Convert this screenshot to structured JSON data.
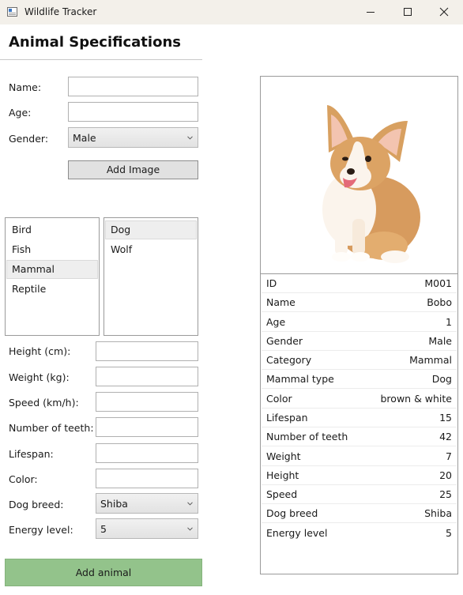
{
  "window": {
    "title": "Wildlife Tracker"
  },
  "form": {
    "heading": "Animal Specifications",
    "name_label": "Name:",
    "name_value": "",
    "age_label": "Age:",
    "age_value": "",
    "gender_label": "Gender:",
    "gender_value": "Male",
    "add_image_label": "Add Image"
  },
  "categories": {
    "items": [
      "Bird",
      "Fish",
      "Mammal",
      "Reptile"
    ],
    "selected": "Mammal"
  },
  "subtypes": {
    "items": [
      "Dog",
      "Wolf"
    ],
    "selected": "Dog"
  },
  "specs": {
    "height_label": "Height (cm):",
    "weight_label": "Weight (kg):",
    "speed_label": "Speed (km/h):",
    "teeth_label": "Number of teeth:",
    "lifespan_label": "Lifespan:",
    "color_label": "Color:",
    "breed_label": "Dog breed:",
    "breed_value": "Shiba",
    "energy_label": "Energy level:",
    "energy_value": "5"
  },
  "add_animal_label": "Add animal",
  "details": [
    {
      "key": "ID",
      "value": "M001"
    },
    {
      "key": "Name",
      "value": "Bobo"
    },
    {
      "key": "Age",
      "value": "1"
    },
    {
      "key": "Gender",
      "value": "Male"
    },
    {
      "key": "Category",
      "value": "Mammal"
    },
    {
      "key": "Mammal type",
      "value": "Dog"
    },
    {
      "key": "Color",
      "value": "brown & white"
    },
    {
      "key": "Lifespan",
      "value": "15"
    },
    {
      "key": "Number of teeth",
      "value": "42"
    },
    {
      "key": "Weight",
      "value": "7"
    },
    {
      "key": "Height",
      "value": "20"
    },
    {
      "key": "Speed",
      "value": "25"
    },
    {
      "key": "Dog breed",
      "value": "Shiba"
    },
    {
      "key": "Energy level",
      "value": "5"
    }
  ],
  "icons": {
    "app": "app-window-icon",
    "minimize": "minimize-icon",
    "maximize": "maximize-icon",
    "close": "close-icon",
    "dropdown": "chevron-down-icon"
  },
  "colors": {
    "titlebar": "#f3f0ea",
    "add_animal_button": "#93c38b",
    "selection": "#eeeeee"
  }
}
